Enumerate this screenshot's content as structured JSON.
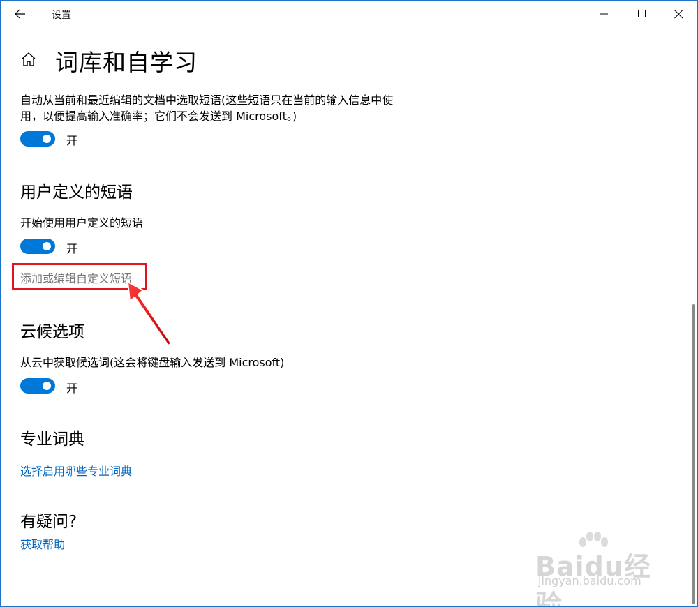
{
  "window": {
    "title": "设置",
    "back_icon": "back-arrow-icon",
    "minimize_icon": "minimize-icon",
    "maximize_icon": "maximize-icon",
    "close_icon": "close-icon"
  },
  "page": {
    "home_icon": "home-icon",
    "title": "词库和自学习"
  },
  "autolearn": {
    "description": "自动从当前和最近编辑的文档中选取短语(这些短语只在当前的输入信息中使用，以便提高输入准确率；它们不会发送到 Microsoft。)",
    "toggle_state": "开"
  },
  "user_phrases": {
    "heading": "用户定义的短语",
    "label": "开始使用用户定义的短语",
    "toggle_state": "开",
    "edit_link": "添加或编辑自定义短语"
  },
  "cloud": {
    "heading": "云候选项",
    "label": "从云中获取候选词(这会将键盘输入发送到 Microsoft)",
    "toggle_state": "开"
  },
  "dictionaries": {
    "heading": "专业词典",
    "link": "选择启用哪些专业词典"
  },
  "help": {
    "heading": "有疑问?",
    "link": "获取帮助"
  },
  "colors": {
    "accent": "#0078d7",
    "link": "#0067c0",
    "annotation": "#e0141e"
  },
  "watermark": {
    "brand": "Baidu经验",
    "url": "jingyan.baidu.com"
  }
}
